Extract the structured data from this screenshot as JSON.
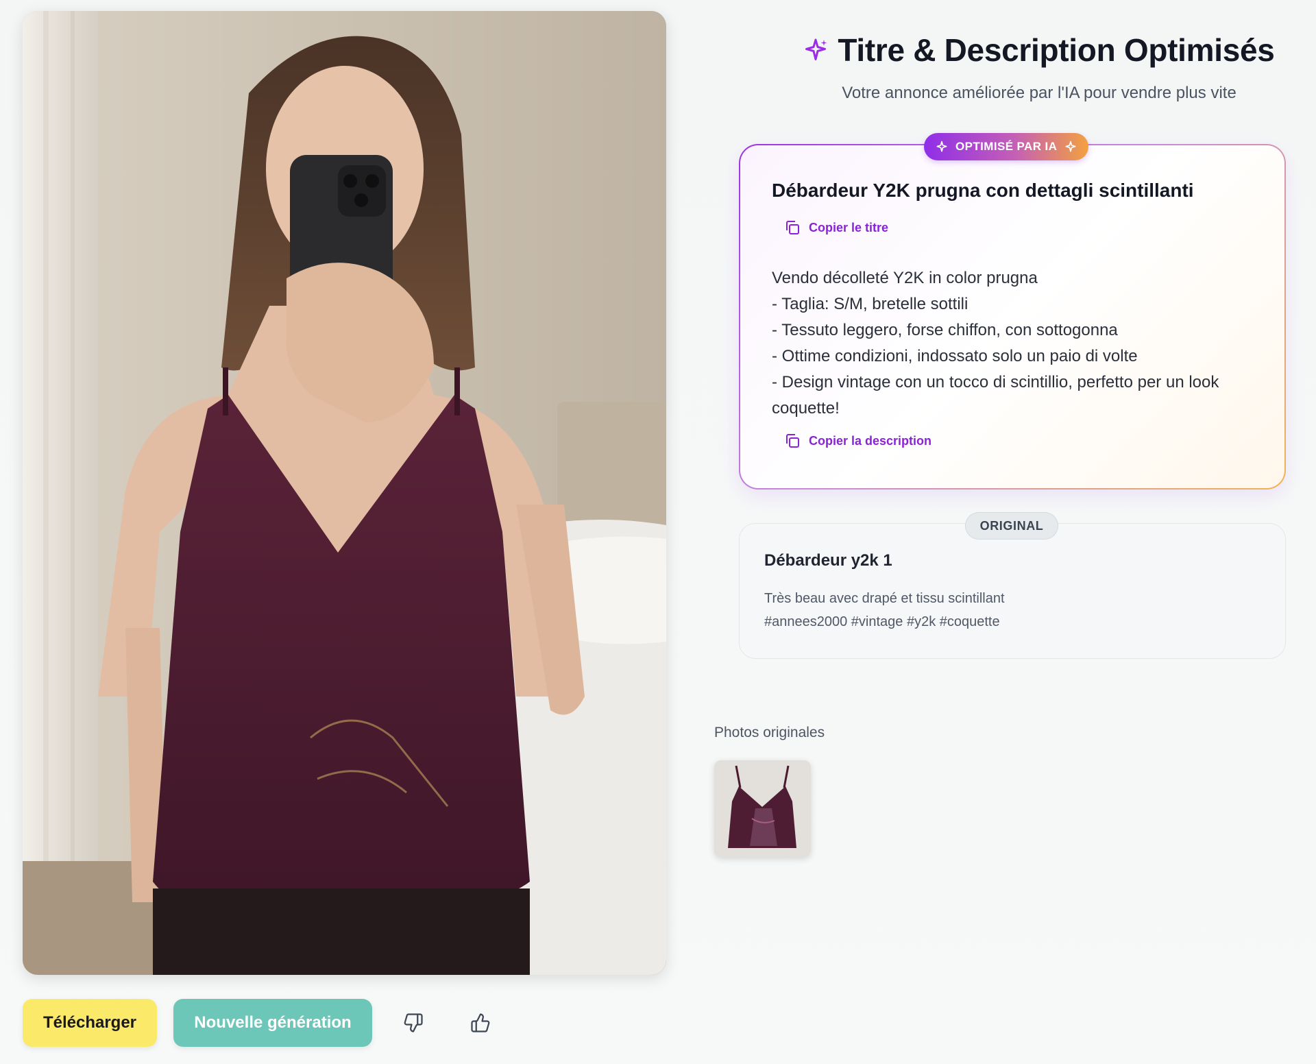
{
  "header": {
    "title": "Titre & Description Optimisés",
    "subtitle": "Votre annonce améliorée par l'IA pour vendre plus vite"
  },
  "ai_card": {
    "badge": "OPTIMISÉ PAR IA",
    "title": "Débardeur Y2K prugna con dettagli scintillanti",
    "copy_title_label": "Copier le titre",
    "description": "Vendo décolleté Y2K in color prugna\n- Taglia: S/M, bretelle sottili\n- Tessuto leggero, forse chiffon, con sottogonna\n- Ottime condizioni, indossato solo un paio di volte\n- Design vintage con un tocco di scintillio, perfetto per un look coquette!",
    "copy_description_label": "Copier la description"
  },
  "original_card": {
    "badge": "ORIGINAL",
    "title": "Débardeur y2k 1",
    "description": "Très beau avec drapé et tissu scintillant\n#annees2000 #vintage #y2k #coquette"
  },
  "original_photos": {
    "label": "Photos originales"
  },
  "actions": {
    "download_label": "Télécharger",
    "regenerate_label": "Nouvelle génération"
  },
  "icons": {
    "sparkle": "sparkle-icon",
    "copy": "copy-icon",
    "thumbs_down": "thumbs-down-icon",
    "thumbs_up": "thumbs-up-icon"
  },
  "colors": {
    "accent_purple": "#8a22d6",
    "accent_orange": "#f3a13f",
    "download_button": "#fbe96a",
    "regenerate_button": "#6cc7b8",
    "garment": "#4a1b2f"
  }
}
